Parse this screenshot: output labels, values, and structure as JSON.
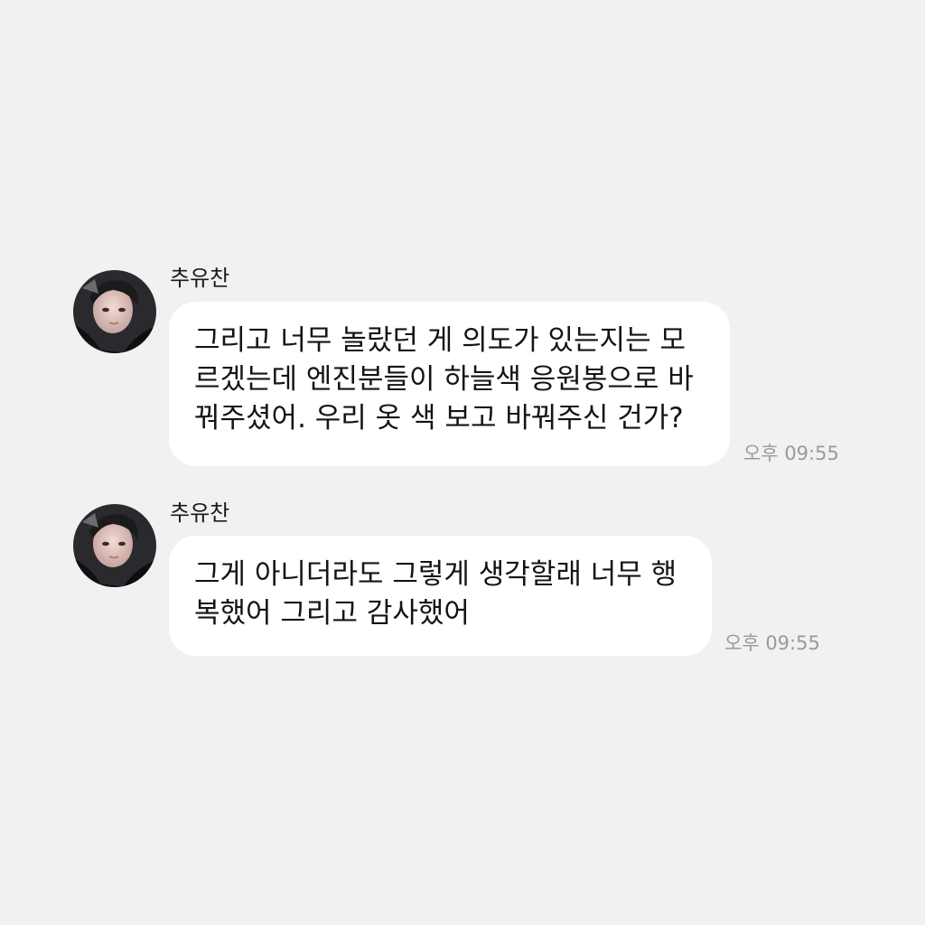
{
  "chat": {
    "messages": [
      {
        "sender": "추유찬",
        "lines": [
          "그리고 너무 놀랐던 게 의도가 있는지는 모",
          "르겠는데 엔진분들이 하늘색 응원봉으로 바",
          "꿔주셨어. 우리 옷 색 보고 바꿔주신 건가?"
        ],
        "time": "오후 09:55"
      },
      {
        "sender": "추유찬",
        "lines": [
          "그게 아니더라도 그렇게 생각할래 너무 행",
          "복했어 그리고 감사했어"
        ],
        "time": "오후 09:55"
      }
    ]
  }
}
